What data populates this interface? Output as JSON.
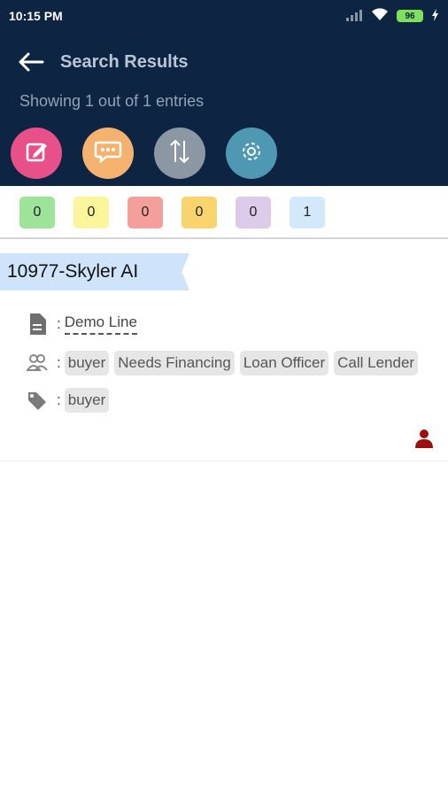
{
  "status_bar": {
    "time": "10:15 PM",
    "battery": "96"
  },
  "header": {
    "title": "Search Results",
    "subtitle": "Showing 1 out of 1 entries",
    "background": "#0d2443"
  },
  "actions": [
    {
      "icon": "edit-icon",
      "color": "#e8508a"
    },
    {
      "icon": "chat-icon",
      "color": "#f5b16e"
    },
    {
      "icon": "sort-icon",
      "color": "#8b98a3"
    },
    {
      "icon": "settings-icon",
      "color": "#4f98b3"
    }
  ],
  "counts": [
    {
      "value": "0",
      "color": "#9de39a"
    },
    {
      "value": "0",
      "color": "#fbf59c"
    },
    {
      "value": "0",
      "color": "#f49f9b"
    },
    {
      "value": "0",
      "color": "#f9d36c"
    },
    {
      "value": "0",
      "color": "#dcccea"
    },
    {
      "value": "1",
      "color": "#d3e8fb"
    }
  ],
  "lead": {
    "name": "10977-Skyler AI",
    "line": "Demo Line",
    "groups": [
      "buyer",
      "Needs Financing",
      "Loan Officer",
      "Call Lender"
    ],
    "tags": [
      "buyer"
    ],
    "owner_icon_color": "#9b0f0f"
  }
}
